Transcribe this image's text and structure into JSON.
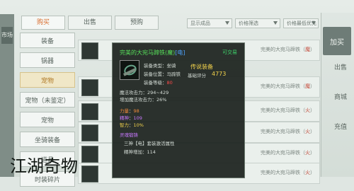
{
  "left_tab": "市场",
  "tabs": [
    "购买",
    "出售",
    "预购"
  ],
  "active_tab_index": 0,
  "filters": [
    {
      "label": "显示成品"
    },
    {
      "label": "价格筛选"
    },
    {
      "label": "价格最低优先"
    }
  ],
  "categories": [
    {
      "label": "装备",
      "selected": false
    },
    {
      "label": "锅器",
      "selected": false
    },
    {
      "label": "宠物",
      "selected": true
    },
    {
      "label": "宠物（未鉴定）",
      "selected": false
    },
    {
      "label": "宠物",
      "selected": false
    },
    {
      "label": "坐骑装备",
      "selected": false
    },
    {
      "label": "道具",
      "selected": false
    },
    {
      "label": "时装碎片",
      "selected": false
    }
  ],
  "right_rail": {
    "top_button": "加买",
    "items": [
      "出售",
      "商城",
      "充值"
    ]
  },
  "list_rows": [
    {
      "tag_prefix": "完美的大宛马蹄铁（",
      "tag_hl": "魔",
      "tag_suffix": "）"
    },
    {
      "tag_prefix": "完美的大宛马蹄铁（",
      "tag_hl": "魔",
      "tag_suffix": "）"
    },
    {
      "tag_prefix": "完美的大宛马蹄铁（",
      "tag_hl": "火",
      "tag_suffix": "）"
    },
    {
      "tag_prefix": "完美的大宛马蹄铁（",
      "tag_hl": "火",
      "tag_suffix": "）"
    },
    {
      "tag_prefix": "完美的大宛马蹄铁（",
      "tag_hl": "火",
      "tag_suffix": "）"
    },
    {
      "tag_prefix": "完美的大宛马蹄铁（",
      "tag_hl": "火",
      "tag_suffix": "）"
    }
  ],
  "tooltip": {
    "title": "完美的大宛马蹄铁(魔)",
    "title_tag": "[电]",
    "equip_status": "可交易",
    "quality": "传说装备",
    "base_score_label": "基础评分",
    "base_score": "4773",
    "type_label": "装备类型",
    "type_value": "坐骑",
    "position_label": "装备位置",
    "position_value": "马蹄铁",
    "level_label": "装备等级",
    "level_value": "80",
    "stats": [
      {
        "label": "魔法攻击力",
        "value": "294~429"
      },
      {
        "label": "增加魔法攻击力",
        "value": "26%"
      }
    ],
    "attr_1_label": "力量",
    "attr_1_value": "98",
    "attr_2_label": "精神",
    "attr_2_value": "109",
    "attr_3_label": "智力",
    "attr_3_value": "10%",
    "special_label": "灵魂锻铸",
    "special_line": "三神【电】套装激活属性",
    "bonus_label": "精神增加",
    "bonus_value": "114"
  },
  "ink_text": "江湖奇物"
}
